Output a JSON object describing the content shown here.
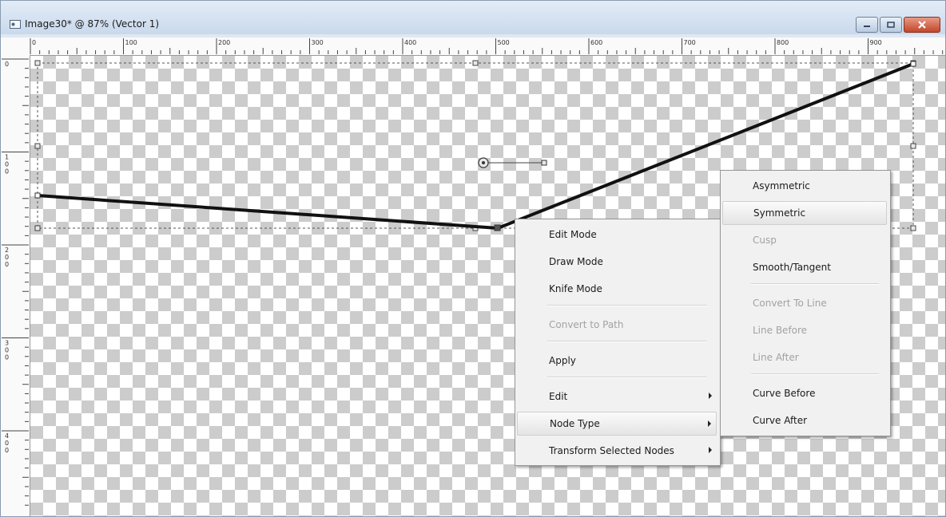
{
  "window": {
    "title": "Image30* @  87% (Vector 1)",
    "controls": [
      "minimize-icon",
      "maximize-icon",
      "close-icon"
    ]
  },
  "rulers": {
    "horizontal": [
      "0",
      "100",
      "200",
      "300",
      "400",
      "500",
      "600",
      "700",
      "800",
      "900"
    ],
    "vertical": [
      {
        "digits": [
          "0"
        ]
      },
      {
        "digits": [
          "1",
          "0",
          "0"
        ]
      },
      {
        "digits": [
          "2",
          "0",
          "0"
        ]
      },
      {
        "digits": [
          "3",
          "0",
          "0"
        ]
      },
      {
        "digits": [
          "4",
          "0",
          "0"
        ]
      }
    ]
  },
  "context_menu": {
    "items": [
      {
        "label": "Edit Mode",
        "enabled": true
      },
      {
        "label": "Draw Mode",
        "enabled": true
      },
      {
        "label": "Knife Mode",
        "enabled": true
      },
      {
        "label": "Convert to Path",
        "enabled": false
      },
      {
        "label": "Apply",
        "enabled": true
      },
      {
        "label": "Edit",
        "enabled": true,
        "submenu": true
      },
      {
        "label": "Node Type",
        "enabled": true,
        "submenu": true,
        "highlighted": true
      },
      {
        "label": "Transform Selected Nodes",
        "enabled": true,
        "submenu": true
      }
    ]
  },
  "node_type_submenu": {
    "items": [
      {
        "label": "Asymmetric",
        "enabled": true
      },
      {
        "label": "Symmetric",
        "enabled": true,
        "highlighted": true
      },
      {
        "label": "Cusp",
        "enabled": false
      },
      {
        "label": "Smooth/Tangent",
        "enabled": true
      },
      {
        "label": "Convert To Line",
        "enabled": false
      },
      {
        "label": "Line Before",
        "enabled": false
      },
      {
        "label": "Line After",
        "enabled": false
      },
      {
        "label": "Curve Before",
        "enabled": true
      },
      {
        "label": "Curve After",
        "enabled": true
      }
    ]
  },
  "colors": {
    "title_bar": "#c9d9ec",
    "close_button": "#c3462b",
    "vector_stroke": "#111111",
    "menu_background": "#f1f1f1",
    "disabled_text": "#a2a2a2"
  }
}
